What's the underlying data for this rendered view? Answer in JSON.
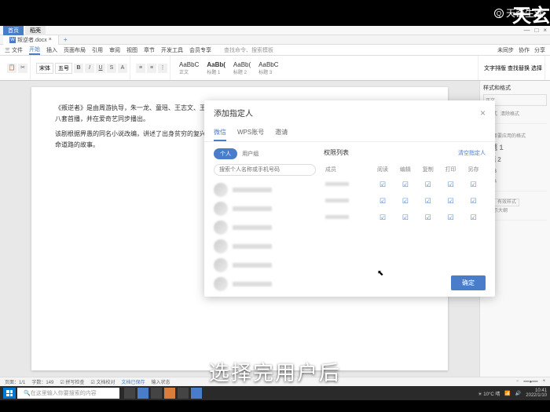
{
  "watermark": {
    "brand": "天奇生活",
    "bigtext": "天玄"
  },
  "titlebar": {
    "tab1": "首页",
    "tab2": "稻壳"
  },
  "doctab": {
    "filename": "叛逆者.docx",
    "close": "×",
    "plus": "+"
  },
  "menubar": {
    "items": [
      "三 文件",
      "开始",
      "插入",
      "页面布局",
      "引用",
      "审阅",
      "视图",
      "章节",
      "开发工具",
      "会员专享"
    ],
    "search_ph": "查找命令、搜索模板",
    "right": [
      "未同步",
      "协作",
      "分享"
    ]
  },
  "toolbar": {
    "font": "宋体",
    "size": "五号",
    "styles": [
      {
        "sample": "AaBbC",
        "label": "正文"
      },
      {
        "sample": "AaBb(",
        "label": "标题 1"
      },
      {
        "sample": "AaBb(",
        "label": "标题 2"
      },
      {
        "sample": "AaBbC",
        "label": "标题 3"
      }
    ],
    "style_more": "文字排版",
    "find": "查找替换",
    "select": "选择"
  },
  "document": {
    "para1": "《叛逆者》是由周游执导，朱一龙、童瑶、王志文、王阳、朱珠、李强、姚安濂、袁文康主演的谍战剧，该剧于2021年6月7日在央视八套首播，并在爱奇艺同步播出。",
    "para2": "该剧根据畀愚的同名小说改编，讲述了出身贫穷的复兴社干部特训班学员林楠笙，在经历信仰和满怀期待、坚持理想，寻找正确的革命道路的故事。"
  },
  "modal": {
    "title": "添加指定人",
    "tabs": [
      "微信",
      "WPS账号",
      "邀请"
    ],
    "chip": "个人",
    "chip_label": "用户组",
    "search_ph": "搜索个人名称或手机号码",
    "perm_title": "权限列表",
    "clear": "清空指定人",
    "columns": [
      "成员",
      "阅读",
      "编辑",
      "复制",
      "打印",
      "另存"
    ],
    "confirm": "确定"
  },
  "right_panel": {
    "title1": "样式和格式",
    "item1": "正文",
    "item2": "新样式",
    "item3": "清除格式",
    "title2": "请选择要应用的格式",
    "styles": [
      "标题 1",
      "标题 2",
      "标题 3",
      "标题 4"
    ],
    "show_label": "显示",
    "show_value": "有效样式",
    "outline": "显示大纲"
  },
  "statusbar": {
    "page": "页面：1/1",
    "words": "字数：149",
    "spell": "拼写检查",
    "doc": "文档校对",
    "insert": "文档已保存",
    "typing": "输入状态"
  },
  "taskbar": {
    "search_ph": "在这里输入你要搜索的内容",
    "weather": "10°C 晴",
    "time": "10:41",
    "date": "2022/1/10"
  },
  "subtitle": "选择完用户后"
}
